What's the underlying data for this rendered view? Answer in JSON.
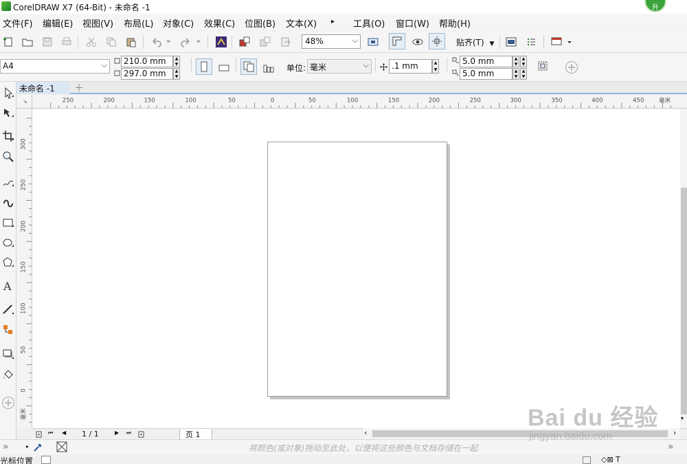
{
  "window": {
    "title": "CorelDRAW X7 (64-Bit) - 未命名 -1",
    "badge": "升"
  },
  "menu": [
    "文件(F)",
    "编辑(E)",
    "视图(V)",
    "布局(L)",
    "对象(C)",
    "效果(C)",
    "位图(B)",
    "文本(X)",
    "▸",
    "工具(O)",
    "窗口(W)",
    "帮助(H)"
  ],
  "toolbar": {
    "zoom": "48%",
    "snap_label": "贴齐(T)"
  },
  "property_bar": {
    "paper_size": "A4",
    "width": "210.0 mm",
    "height": "297.0 mm",
    "unit_label": "单位:",
    "unit_value": "毫米",
    "nudge": ".1 mm",
    "dup_x": "5.0 mm",
    "dup_y": "5.0 mm"
  },
  "document_tab": {
    "label": "未命名 -1"
  },
  "ruler": {
    "top_labels": [
      "250",
      "200",
      "150",
      "100",
      "50",
      "0",
      "50",
      "100",
      "150",
      "200",
      "250",
      "300",
      "350",
      "400",
      "450",
      "毫米"
    ],
    "left_labels": [
      "300",
      "250",
      "200",
      "150",
      "100",
      "50",
      "0",
      "毫米"
    ]
  },
  "page_navigator": {
    "counter": "1 / 1",
    "page_tab": "页 1"
  },
  "palette": {
    "hint": "将颜色(或对象)拖动至此处，以便将这些颜色与文档存储在一起"
  },
  "status": {
    "cursor_label": "光标位置"
  },
  "watermark": {
    "main": "Bai du 经验",
    "sub": "jingyan.baidu.com"
  },
  "colors": {
    "accent": "#8ab4dc",
    "canvas": "#ffffff",
    "chrome": "#f5f5f5"
  }
}
